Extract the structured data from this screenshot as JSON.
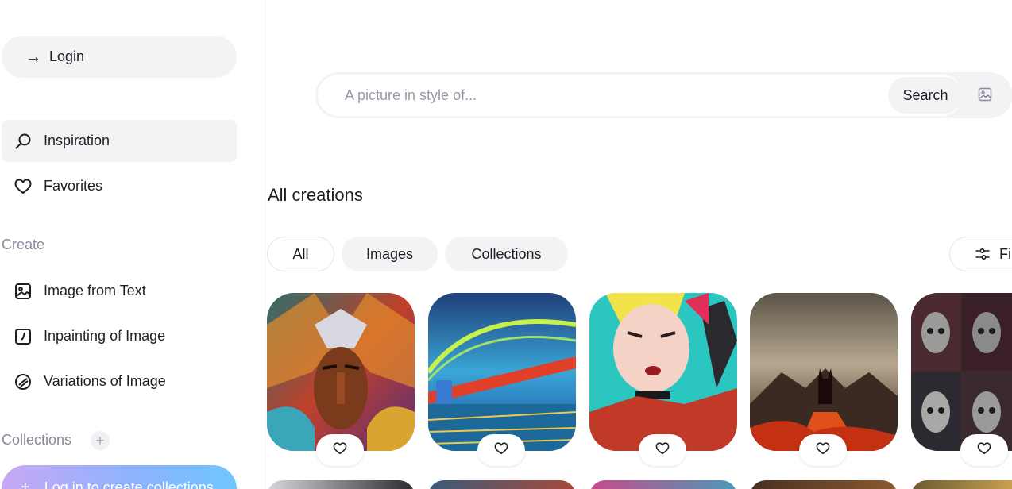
{
  "sidebar": {
    "login_label": "Login",
    "nav": [
      {
        "label": "Inspiration",
        "icon": "search-icon",
        "active": true
      },
      {
        "label": "Favorites",
        "icon": "heart-icon",
        "active": false
      }
    ],
    "create_label": "Create",
    "create_items": [
      {
        "label": "Image from Text",
        "icon": "image-icon"
      },
      {
        "label": "Inpainting of Image",
        "icon": "inpainting-icon"
      },
      {
        "label": "Variations of Image",
        "icon": "variations-icon"
      }
    ],
    "collections_label": "Collections",
    "create_collections_label": "Log in to create collections"
  },
  "search": {
    "placeholder": "A picture in style of...",
    "button_label": "Search"
  },
  "main": {
    "heading": "All creations",
    "filters": [
      "All",
      "Images",
      "Collections"
    ],
    "filter_button_label": "Filters"
  },
  "colors": {
    "accent_gradient_start": "#c8a8f5",
    "accent_gradient_end": "#6fc6ff",
    "chip_bg": "#f3f3f6",
    "muted_text": "#8a8a9a"
  }
}
